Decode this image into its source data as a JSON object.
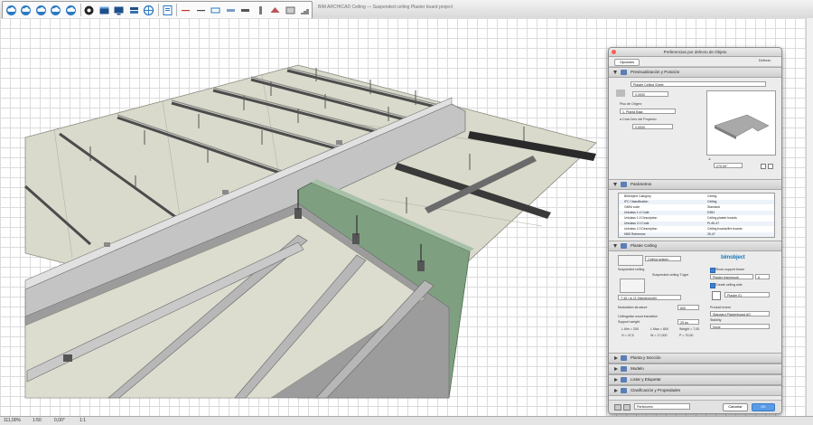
{
  "window": {
    "title": "BIM ARCHICAD Ceiling — Suspended ceiling Plaster board project"
  },
  "status_bar": {
    "zoom": "111,00%",
    "scale": "1:50",
    "angle": "0,00°",
    "layer": "1:1"
  },
  "palette": {
    "title": "Preferencias por defecto de Objeto",
    "select_button": "Opciones",
    "default_label": "Defecto",
    "sections": {
      "preview": {
        "header": "Previsualización y Posición",
        "object_name": "Plaster Ceiling Sheet",
        "field_1": "0,0000",
        "floor_label": "Piso de Origen:",
        "floor_value": "1. Planta Baja",
        "offset_label": "a Cota Cero del Proyecto:",
        "offset_value": "0,0000",
        "angle_value": "270,00°"
      },
      "parameters": {
        "header": "Parámetros",
        "rows": [
          {
            "name": "BIMobject Category",
            "value": "Ceiling"
          },
          {
            "name": "IFC Classification",
            "value": "Ceiling"
          },
          {
            "name": "OMNI code",
            "value": "Standard"
          },
          {
            "name": "Uniclass 1.4 Code",
            "value": "D351"
          },
          {
            "name": "Uniclass 1.4 Description",
            "value": "Ceiling plaster boards"
          },
          {
            "name": "Uniclass 2.0 Code",
            "value": "Pr-60-47"
          },
          {
            "name": "Uniclass 2.0 Description",
            "value": "Ceiling boards/fire boards"
          },
          {
            "name": "NBS Reference",
            "value": "25-47"
          }
        ]
      },
      "plaster": {
        "header": "Plaster Ceiling",
        "system_label": "Ceiling system",
        "bim_logo_text": "bimobject",
        "suspended_label": "Suspended ceiling",
        "framework_label": "Suspended ceiling T-type",
        "profile_value": "T 45 / ts (Z-Ständerprofil)",
        "ceiling_check": "Show support beam",
        "beam_type": "Plaster framework",
        "hole_count": "6",
        "create_ceiling_label": "Create ceiling side",
        "material_value": "Plaster 01",
        "modulation_label": "Modulation structure",
        "modulation_value": "600",
        "thermal_label": "Ceilingwise wood insulation",
        "support_label": "Support weight",
        "support_value": "25 kg",
        "dims": [
          "L.Min = 200",
          "L.Max = 800",
          "Weight = 7,00"
        ],
        "dims2": [
          "H = 47,5",
          "W = 17,000",
          "P = 70,00"
        ],
        "product_label": "Product brand",
        "product_value": "Standard Plasterboard AG",
        "density_label": "Stability",
        "density_value": "None"
      },
      "collapsed": [
        "Planta y Sección",
        "Modelo",
        "Listar y Etiquetar",
        "Clasificación y Propiedades"
      ]
    },
    "footer": {
      "layer_value": "Particiones",
      "cancel": "Cancelar",
      "ok": "OK"
    }
  }
}
